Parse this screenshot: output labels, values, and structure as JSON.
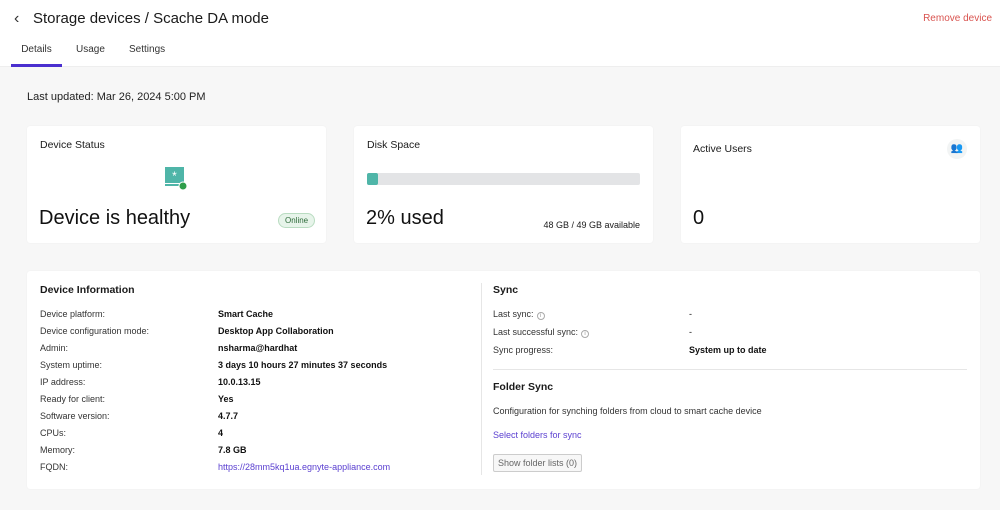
{
  "header": {
    "back_icon": "chevron-left-icon",
    "title": "Storage devices / Scache DA mode",
    "remove_label": "Remove device"
  },
  "tabs": [
    {
      "label": "Details"
    },
    {
      "label": "Usage"
    },
    {
      "label": "Settings"
    }
  ],
  "last_updated": "Last updated: Mar 26, 2024 5:00 PM",
  "device_status": {
    "title": "Device Status",
    "status": "Device is healthy",
    "badge": "Online",
    "icon": "smart-cache-device-icon"
  },
  "disk_space": {
    "title": "Disk Space",
    "used_label": "2% used",
    "used_percent": 2,
    "available": "48 GB / 49 GB available"
  },
  "active_users": {
    "title": "Active Users",
    "count": "0",
    "icon": "users-icon"
  },
  "device_info": {
    "title": "Device Information",
    "rows": [
      {
        "label": "Device platform:",
        "value": "Smart Cache"
      },
      {
        "label": "Device configuration mode:",
        "value": "Desktop App Collaboration"
      },
      {
        "label": "Admin:",
        "value": "nsharma@hardhat"
      },
      {
        "label": "System uptime:",
        "value": "3 days 10 hours 27 minutes 37 seconds"
      },
      {
        "label": "IP address:",
        "value": "10.0.13.15"
      },
      {
        "label": "Ready for client:",
        "value": "Yes"
      },
      {
        "label": "Software version:",
        "value": "4.7.7"
      },
      {
        "label": "CPUs:",
        "value": "4"
      },
      {
        "label": "Memory:",
        "value": "7.8 GB"
      },
      {
        "label": "FQDN:",
        "value": "https://28mm5kq1ua.egnyte-appliance.com"
      }
    ]
  },
  "sync": {
    "title": "Sync",
    "rows": [
      {
        "label": "Last sync:",
        "value": "-"
      },
      {
        "label": "Last successful sync:",
        "value": "-"
      },
      {
        "label": "Sync progress:",
        "value": "System up to date"
      }
    ]
  },
  "folder_sync": {
    "title": "Folder Sync",
    "description": "Configuration for synching folders from cloud to smart cache device",
    "select_link": "Select folders for sync",
    "show_button": "Show folder lists (0)"
  }
}
